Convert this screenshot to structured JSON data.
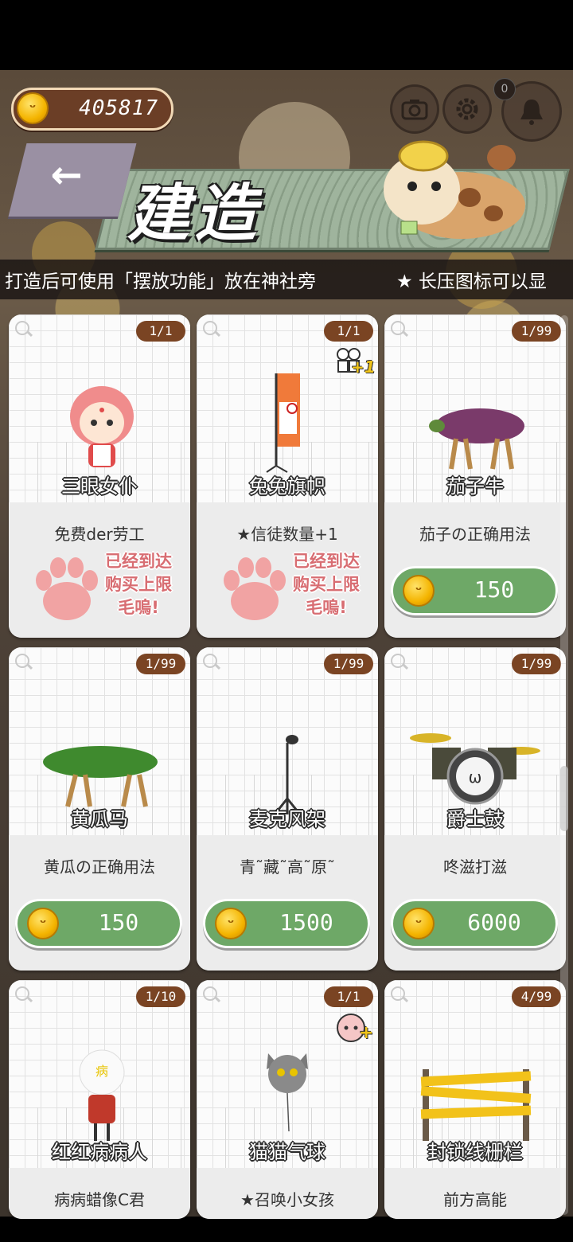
{
  "header": {
    "coins": "405817",
    "title": "建造",
    "back_icon": "←",
    "notification_count": "0",
    "hint": "打造后可使用「摆放功能」放在神社旁",
    "hint2": "★ 长压图标可以显"
  },
  "items": [
    {
      "name": "三眼女仆",
      "desc": "免费der劳工",
      "count": "1/1",
      "status": "sold_out",
      "sold_out_text": [
        "已经到达",
        "购买上限",
        "毛嗚!"
      ]
    },
    {
      "name": "兔兔旗帜",
      "desc": "★信徒数量+1",
      "count": "1/1",
      "status": "sold_out",
      "badge": "+1",
      "sold_out_text": [
        "已经到达",
        "购买上限",
        "毛嗚!"
      ]
    },
    {
      "name": "茄子牛",
      "desc": "茄子の正确用法",
      "count": "1/99",
      "status": "buy",
      "price": "150"
    },
    {
      "name": "黄瓜马",
      "desc": "黄瓜の正确用法",
      "count": "1/99",
      "status": "buy",
      "price": "150"
    },
    {
      "name": "麦克风架",
      "desc": "青˜藏˜高˜原˜",
      "count": "1/99",
      "status": "buy",
      "price": "1500"
    },
    {
      "name": "爵士鼓",
      "desc": "咚滋打滋",
      "count": "1/99",
      "status": "buy",
      "price": "6000"
    },
    {
      "name": "红红病病人",
      "desc": "病病蜡像C君",
      "count": "1/10",
      "status": "partial"
    },
    {
      "name": "猫猫气球",
      "desc": "★召唤小女孩",
      "count": "1/1",
      "status": "partial",
      "badge": "+"
    },
    {
      "name": "封锁线栅栏",
      "desc": "前方高能",
      "count": "4/99",
      "status": "partial"
    }
  ],
  "colors": {
    "buy_button": "#6ea867",
    "count_badge": "#7a4423",
    "sold_out_text": "#d86d72"
  }
}
